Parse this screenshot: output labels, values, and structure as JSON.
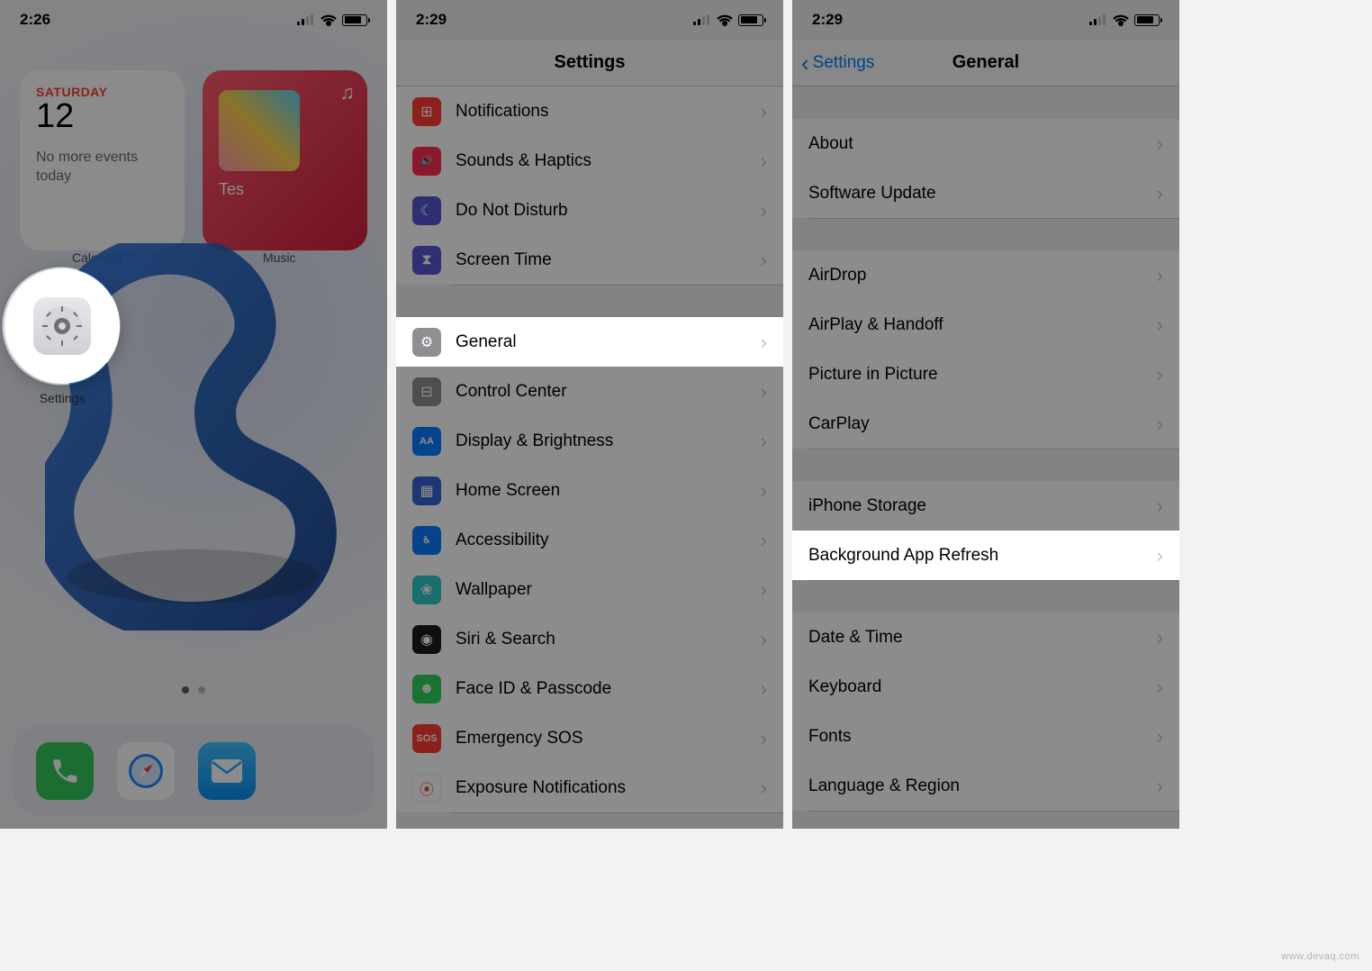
{
  "watermark": "www.devaq.com",
  "phone1": {
    "time": "2:26",
    "calendar": {
      "day": "SATURDAY",
      "date": "12",
      "events": "No more events today",
      "caption": "Calendar"
    },
    "music": {
      "track": "Tes",
      "caption": "Music"
    },
    "settings_caption": "Settings",
    "dock": [
      {
        "name": "phone-icon",
        "color": "#34c759",
        "glyph": "✆"
      },
      {
        "name": "safari-icon",
        "color": "#1f87ff",
        "glyph": "◎"
      },
      {
        "name": "mail-icon",
        "color": "#1eaaf1",
        "glyph": "✉"
      }
    ]
  },
  "phone2": {
    "time": "2:29",
    "title": "Settings",
    "rows": [
      {
        "id": "notifications",
        "label": "Notifications",
        "color": "#ff3b30",
        "glyph": "⊞"
      },
      {
        "id": "sounds",
        "label": "Sounds & Haptics",
        "color": "#ff2d55",
        "glyph": "🔊"
      },
      {
        "id": "dnd",
        "label": "Do Not Disturb",
        "color": "#5856d6",
        "glyph": "☾"
      },
      {
        "id": "screentime",
        "label": "Screen Time",
        "color": "#5856d6",
        "glyph": "⧗"
      },
      {
        "id": "general",
        "label": "General",
        "color": "#8e8e93",
        "glyph": "⚙",
        "highlight": true
      },
      {
        "id": "control-center",
        "label": "Control Center",
        "color": "#8e8e93",
        "glyph": "⊟"
      },
      {
        "id": "display",
        "label": "Display & Brightness",
        "color": "#0a7aff",
        "glyph": "AA"
      },
      {
        "id": "home-screen",
        "label": "Home Screen",
        "color": "#3763d6",
        "glyph": "▦"
      },
      {
        "id": "accessibility",
        "label": "Accessibility",
        "color": "#0a7aff",
        "glyph": "♿︎"
      },
      {
        "id": "wallpaper",
        "label": "Wallpaper",
        "color": "#2ec8c8",
        "glyph": "❀"
      },
      {
        "id": "siri",
        "label": "Siri & Search",
        "color": "#1c1c1e",
        "glyph": "◉"
      },
      {
        "id": "faceid",
        "label": "Face ID & Passcode",
        "color": "#30d158",
        "glyph": "☻"
      },
      {
        "id": "sos",
        "label": "Emergency SOS",
        "color": "#ff3b30",
        "glyph": "SOS"
      },
      {
        "id": "exposure",
        "label": "Exposure Notifications",
        "color": "#ffffff",
        "glyph": "⦿"
      }
    ]
  },
  "phone3": {
    "time": "2:29",
    "back": "Settings",
    "title": "General",
    "groups": [
      [
        {
          "id": "about",
          "label": "About"
        },
        {
          "id": "software-update",
          "label": "Software Update"
        }
      ],
      [
        {
          "id": "airdrop",
          "label": "AirDrop"
        },
        {
          "id": "airplay",
          "label": "AirPlay & Handoff"
        },
        {
          "id": "pip",
          "label": "Picture in Picture"
        },
        {
          "id": "carplay",
          "label": "CarPlay"
        }
      ],
      [
        {
          "id": "storage",
          "label": "iPhone Storage"
        },
        {
          "id": "bg-refresh",
          "label": "Background App Refresh",
          "highlight": true
        }
      ],
      [
        {
          "id": "date-time",
          "label": "Date & Time"
        },
        {
          "id": "keyboard",
          "label": "Keyboard"
        },
        {
          "id": "fonts",
          "label": "Fonts"
        },
        {
          "id": "lang",
          "label": "Language & Region"
        }
      ]
    ]
  }
}
